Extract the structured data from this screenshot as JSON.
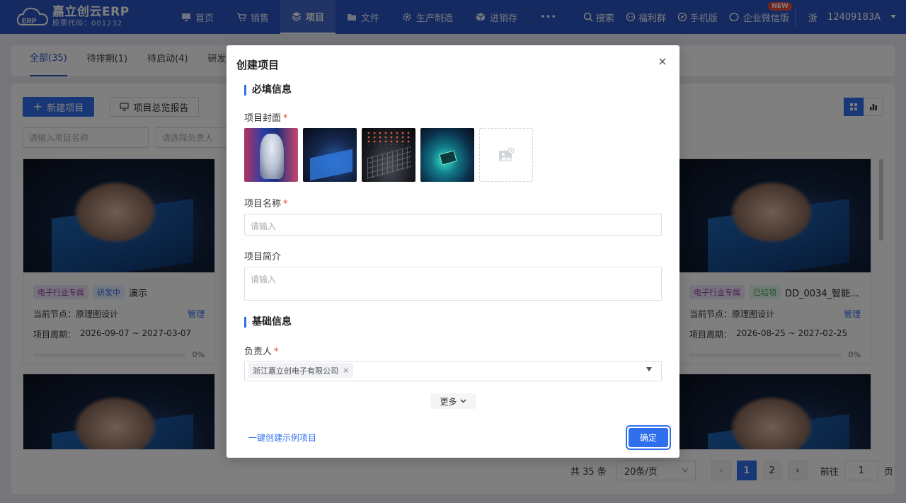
{
  "header": {
    "logo_title": "嘉立创云ERP",
    "logo_sub": "股票代码：001232",
    "nav": [
      {
        "label": "首页",
        "icon": "monitor-icon"
      },
      {
        "label": "销售",
        "icon": "cart-icon"
      },
      {
        "label": "项目",
        "icon": "layers-icon",
        "active": true
      },
      {
        "label": "文件",
        "icon": "folder-icon"
      },
      {
        "label": "生产制造",
        "icon": "gear-icon"
      },
      {
        "label": "进销存",
        "icon": "box-icon"
      },
      {
        "label": "•••",
        "icon": ""
      }
    ],
    "search": "搜索",
    "welfare": "福利群",
    "mobile": "手机版",
    "wecom": "企业微信版",
    "new_badge": "NEW",
    "region": "浙",
    "account": "12409183A"
  },
  "tabs": [
    "全部(35)",
    "待排期(1)",
    "待启动(4)",
    "研发中"
  ],
  "toolbar": {
    "new_project": "新建项目",
    "overview_report": "项目总览报告",
    "name_placeholder": "请输入项目名称",
    "owner_placeholder": "请选择负责人"
  },
  "cards": [
    {
      "industry": "电子行业专属",
      "status": "研发中",
      "status_type": "dev",
      "title": "演示",
      "node_label": "当前节点：",
      "node": "原理图设计",
      "manage": "管理",
      "period_label": "项目周期：",
      "period": "2026-09-07 ~ 2027-03-07",
      "progress": "0%"
    },
    {
      "industry": "电子行业专属",
      "status": "已结项",
      "status_type": "done",
      "title": "DD_0034_智能...",
      "node_label": "当前节点：",
      "node": "原理图设计",
      "manage": "管理",
      "period_label": "项目周期：",
      "period": "2026-08-25 ~ 2027-02-25",
      "progress": "0%"
    }
  ],
  "pagination": {
    "total": "共 35 条",
    "page_size": "20条/页",
    "pages": [
      "1",
      "2"
    ],
    "goto_label": "前往",
    "goto_value": "1",
    "page_unit": "页"
  },
  "modal": {
    "title": "创建项目",
    "close": "×",
    "section_required": "必填信息",
    "cover_label": "项目封面",
    "name_label": "项目名称",
    "name_placeholder": "请输入",
    "intro_label": "项目简介",
    "intro_placeholder": "请输入",
    "section_basic": "基础信息",
    "owner_label": "负责人",
    "owner_value": "浙江嘉立创电子有限公司",
    "more": "更多",
    "quick_create": "一键创建示例项目",
    "confirm": "确定",
    "required_mark": "*"
  }
}
